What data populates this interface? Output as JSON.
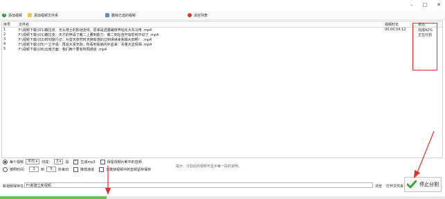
{
  "window": {
    "minimize": "–",
    "maximize": "□",
    "close": "✕"
  },
  "toolbar": {
    "add_video": "添加视频",
    "add_folder": "添加视频文件夹",
    "remove_selected": "删除已选的视频",
    "clear_list": "清空列表"
  },
  "table": {
    "headers": {
      "no": "序号",
      "file": "文件名",
      "duration": "视频时长",
      "status": "状态"
    },
    "rows": [
      {
        "no": "1",
        "file": "F:\\视频下载\\(01)戴拉克：无头骑士的影谜走线，原来是透露编夜奔钻化大东马电 .mp4",
        "duration": "00:00:54.12",
        "status": "完成42%"
      },
      {
        "no": "2",
        "file": "F:\\视频下载\\(01)戴拉克：天才的申请了戴二上腰到能力：戴二到在连开有影响不动了 .mp4",
        "duration": "",
        "status": "正在分割"
      },
      {
        "no": "3",
        "file": "F:\\视频下载\\(03)时刻旅行记：为雷天突然时天拥有感的过到误读来我偶大四啊！ .mp4",
        "duration": "",
        "status": ""
      },
      {
        "no": "4",
        "file": "F:\\视频下载\\(05)一立平强：再说大贤天际，所看到看病内外血来：青量大显情相 .mp4",
        "duration": "",
        "status": ""
      },
      {
        "no": "5",
        "file": "F:\\视频下载\\(06)云南方面：我们两个要有所网通道 .mp4",
        "duration": "",
        "status": ""
      }
    ]
  },
  "controls": {
    "each_video": "每个视频",
    "mode_value": "平均",
    "segments_label": "切成：",
    "segments_value": "3",
    "segments_unit": "段",
    "gen_mp3": "生成mp3",
    "keep_frames": "保留视频片断中的音频",
    "by_duration": "按照时间：",
    "from_value": "3",
    "to_label": "到",
    "to_value": "5",
    "seconds_cut": "秒来切",
    "reduce_channels": "降低通道",
    "remove_audio": "只删掉视频中的音频留存保存",
    "hint": "提示：分割后的视频可显示每一段的说明。"
  },
  "save": {
    "label": "新视频保存在：",
    "path": "F:\\新建立新视频",
    "browse": "浏览",
    "open_folder": "打开文件夹"
  },
  "stop_button": {
    "label": "停止分割"
  },
  "progress": {
    "value": 0.24
  },
  "colors": {
    "accent_red": "#e32c2c",
    "progress_green": "#66c254",
    "check_green": "#3aa63a"
  }
}
